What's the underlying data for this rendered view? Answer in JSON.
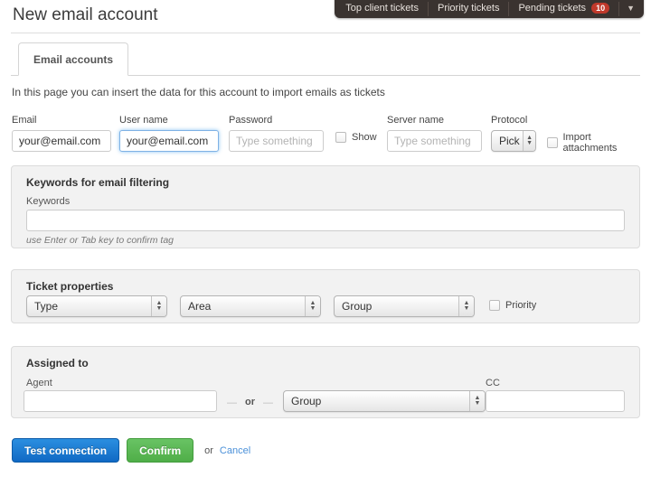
{
  "topbar": {
    "items": [
      {
        "label": "Top client tickets",
        "badge": null
      },
      {
        "label": "Priority tickets",
        "badge": null
      },
      {
        "label": "Pending tickets",
        "badge": "10"
      }
    ],
    "caret_icon": "chevron-down-icon",
    "caret_glyph": "▼"
  },
  "header": {
    "title": "New email account"
  },
  "tabs": [
    {
      "label": "Email accounts",
      "active": true
    }
  ],
  "intro": "In this page you can insert the data for this account to import emails as tickets",
  "fields": {
    "email": {
      "label": "Email",
      "value": "your@email.com",
      "placeholder": ""
    },
    "username": {
      "label": "User name",
      "value": "your@email.com",
      "placeholder": "",
      "focused": true
    },
    "password": {
      "label": "Password",
      "value": "",
      "placeholder": "Type something ..."
    },
    "show": {
      "label": "Show",
      "checked": false
    },
    "server": {
      "label": "Server name",
      "value": "",
      "placeholder": "Type something ..."
    },
    "protocol": {
      "label": "Protocol",
      "value": "Pick"
    },
    "import_attachments": {
      "label": "Import attachments",
      "checked": false
    }
  },
  "keywords_panel": {
    "title": "Keywords for email filtering",
    "field_label": "Keywords",
    "value": "",
    "hint": "use Enter or Tab key to confirm tag"
  },
  "ticket_properties": {
    "title": "Ticket properties",
    "type": {
      "value": "Type"
    },
    "area": {
      "value": "Area"
    },
    "group": {
      "value": "Group"
    },
    "priority": {
      "label": "Priority",
      "checked": false
    }
  },
  "assigned_to": {
    "title": "Assigned to",
    "agent_label": "Agent",
    "agent_value": "",
    "or": "or",
    "group": {
      "value": "Group"
    },
    "cc_label": "CC",
    "cc_value": ""
  },
  "actions": {
    "test_connection": "Test connection",
    "confirm": "Confirm",
    "or": "or",
    "cancel": "Cancel"
  },
  "colors": {
    "accent_blue": "#1069c4",
    "accent_green": "#4fae48",
    "badge_red": "#c0392b",
    "topbar_dark": "#3a3330",
    "panel_bg": "#f2f2f2",
    "link_blue": "#4a90d9"
  },
  "select_arrow_glyph_up": "▲",
  "select_arrow_glyph_down": "▼"
}
